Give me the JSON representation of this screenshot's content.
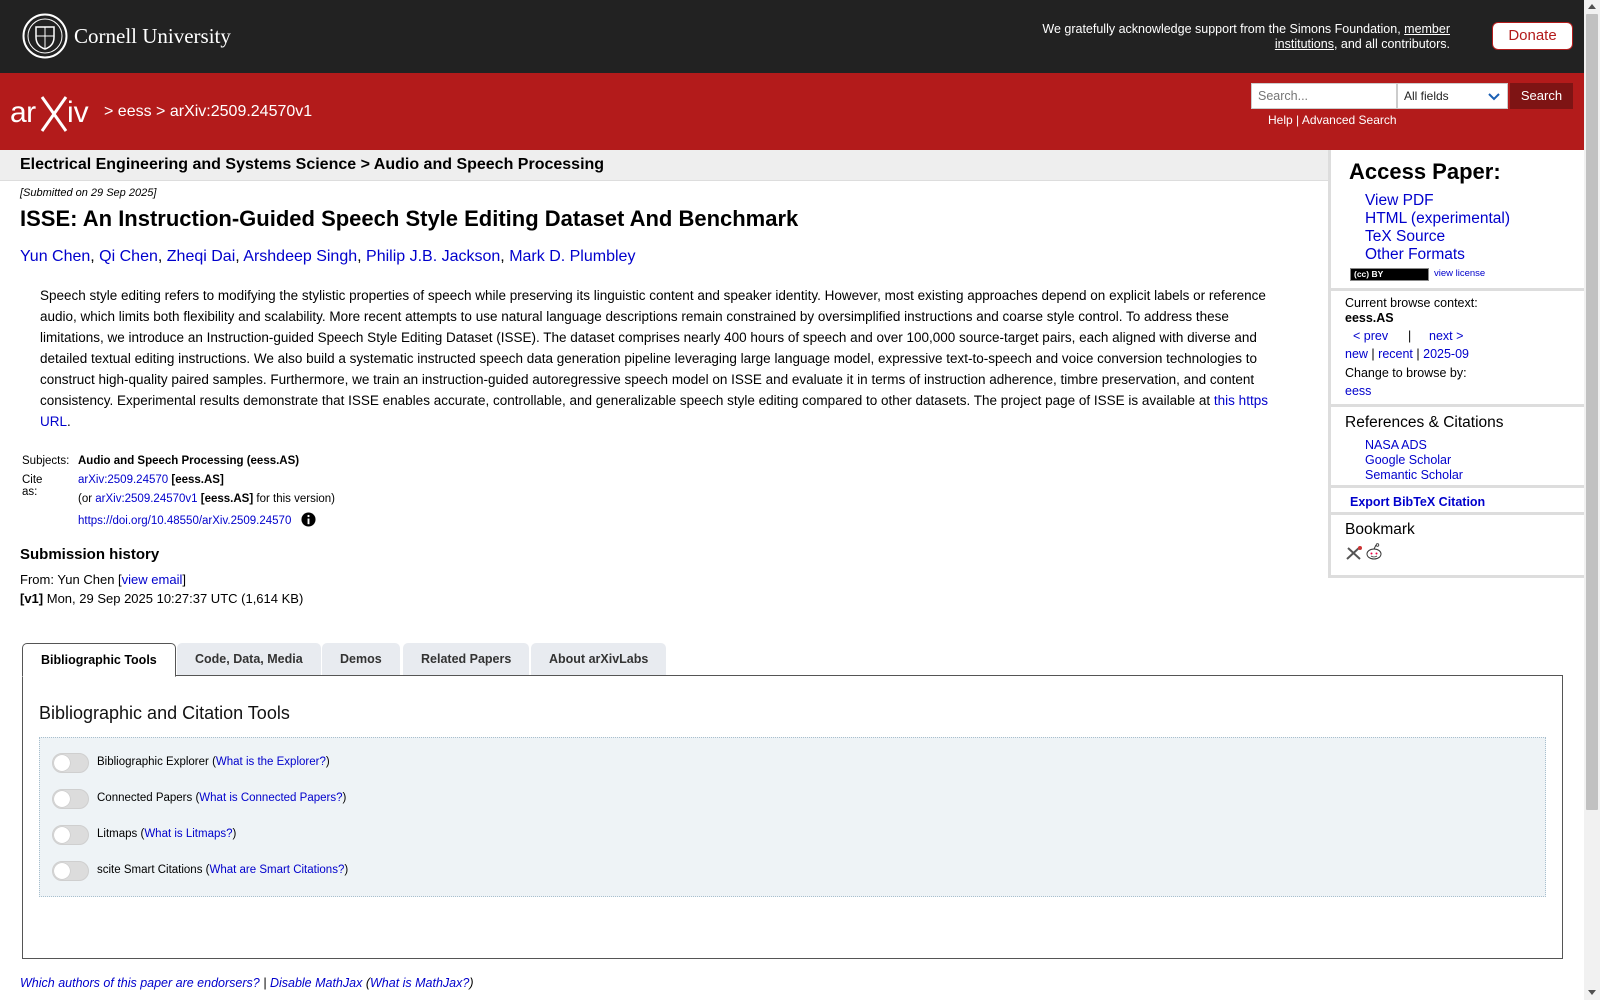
{
  "topbar": {
    "institution": "Cornell University",
    "support_prefix": "We gratefully acknowledge support from the Simons Foundation,",
    "support_link": "member institutions",
    "support_suffix": ", and all contributors.",
    "donate_label": "Donate"
  },
  "header": {
    "breadcrumb_sep": ">",
    "breadcrumb_archive": "eess",
    "breadcrumb_id": "arXiv:2509.24570v1",
    "search_placeholder": "Search...",
    "search_field": "All fields",
    "search_button": "Search",
    "help_link": "Help",
    "link_sep": "|",
    "advanced_link": "Advanced Search"
  },
  "paper": {
    "subject_line": "Electrical Engineering and Systems Science > Audio and Speech Processing",
    "submitted": "[Submitted on 29 Sep 2025]",
    "title": "ISSE: An Instruction-Guided Speech Style Editing Dataset And Benchmark",
    "authors": [
      "Yun Chen",
      "Qi Chen",
      "Zheqi Dai",
      "Arshdeep Singh",
      "Philip J.B. Jackson",
      "Mark D. Plumbley"
    ],
    "author_sep": ", ",
    "abstract": "Speech style editing refers to modifying the stylistic properties of speech while preserving its linguistic content and speaker identity. However, most existing approaches depend on explicit labels or reference audio, which limits both flexibility and scalability. More recent attempts to use natural language descriptions remain constrained by oversimplified instructions and coarse style control. To address these limitations, we introduce an Instruction-guided Speech Style Editing Dataset (ISSE). The dataset comprises nearly 400 hours of speech and over 100,000 source-target pairs, each aligned with diverse and detailed textual editing instructions. We also build a systematic instructed speech data generation pipeline leveraging large language model, expressive text-to-speech and voice conversion technologies to construct high-quality paired samples. Furthermore, we train an instruction-guided autoregressive speech model on ISSE and evaluate it in terms of instruction adherence, timbre preservation, and content consistency. Experimental results demonstrate that ISSE enables accurate, controllable, and generalizable speech style editing compared to other datasets. The project page of ISSE is available at ",
    "abstract_link": "this https URL",
    "abstract_end": ".",
    "subjects_label": "Subjects:",
    "subjects_value": "Audio and Speech Processing (eess.AS)",
    "cite_label": "Cite as:",
    "cite_id": "arXiv:2509.24570",
    "cite_tag": "[eess.AS]",
    "cite_version_prefix": "(or ",
    "cite_version_id": "arXiv:2509.24570v1",
    "cite_version_tag": "[eess.AS]",
    "cite_version_suffix": " for this version)",
    "doi": "https://doi.org/10.48550/arXiv.2509.24570",
    "history_heading": "Submission history",
    "history_from_prefix": "From: Yun Chen [",
    "history_view_email": "view email",
    "history_from_suffix": "]",
    "history_v1_tag": "[v1]",
    "history_v1_text": " Mon, 29 Sep 2025 10:27:37 UTC (1,614 KB)"
  },
  "sidebar": {
    "access_heading": "Access Paper:",
    "access_links": [
      "View PDF",
      "HTML (experimental)",
      "TeX Source",
      "Other Formats"
    ],
    "license_badge": "(cc) BY",
    "view_license": "view license",
    "context_label": "Current browse context:",
    "context_value": "eess.AS",
    "prev_link": "< prev",
    "nav_sep": "|",
    "next_link": "next >",
    "new_link": "new",
    "recent_link": "recent",
    "month_link": "2025-09",
    "change_label": "Change to browse by:",
    "eess_link": "eess",
    "refs_heading": "References & Citations",
    "ref_links": [
      "NASA ADS",
      "Google Scholar",
      "Semantic Scholar"
    ],
    "export_bibtex": "Export BibTeX Citation",
    "bookmark_heading": "Bookmark"
  },
  "tabs": {
    "items": [
      "Bibliographic Tools",
      "Code, Data, Media",
      "Demos",
      "Related Papers",
      "About arXivLabs"
    ],
    "active_index": 0,
    "panel_heading": "Bibliographic and Citation Tools",
    "tools": [
      {
        "name": "Bibliographic Explorer",
        "help": "What is the Explorer?",
        "enabled": false
      },
      {
        "name": "Connected Papers",
        "help": "What is Connected Papers?",
        "enabled": false
      },
      {
        "name": "Litmaps",
        "help": "What is Litmaps?",
        "enabled": false
      },
      {
        "name": "scite Smart Citations",
        "help": "What are Smart Citations?",
        "enabled": false
      }
    ]
  },
  "footer": {
    "endorsers_link": "Which authors of this paper are endorsers?",
    "sep": "|",
    "mathjax_link": "Disable MathJax",
    "mathjax_help_prefix": "(",
    "mathjax_help_link": "What is MathJax?",
    "mathjax_help_suffix": ")"
  },
  "colors": {
    "arxiv_red": "#b31b1b",
    "topbar_dark": "#222222",
    "link_blue": "#0000cc"
  }
}
